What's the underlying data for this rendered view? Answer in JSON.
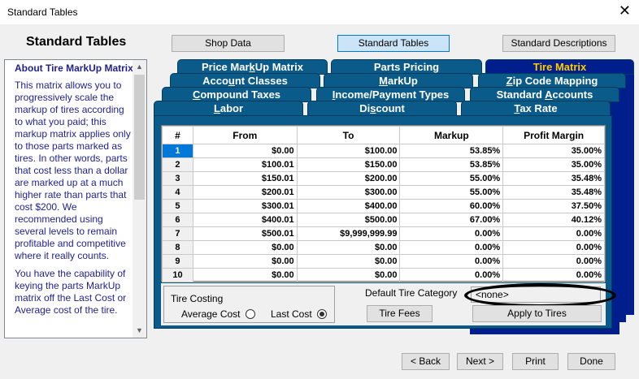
{
  "window": {
    "title": "Standard Tables"
  },
  "page": {
    "heading": "Standard Tables"
  },
  "top_buttons": [
    {
      "label": "Shop Data"
    },
    {
      "label": "Standard Tables"
    },
    {
      "label": "Standard Descriptions"
    }
  ],
  "side": {
    "title": "About Tire MarkUp Matrix",
    "p1": "This matrix allows you to progressively scale the markup of tires according to what you paid; this markup matrix applies only to those parts marked as tires. In other words, parts that cost less than a dollar are marked up at a much higher rate than parts that cost $200. We recommended using several levels to remain profitable and competitive where it really counts.",
    "p2": "You have the capability of keying the parts MarkUp matrix off the Last Cost or Average cost of the tire."
  },
  "tabs": {
    "row1": [
      {
        "pre": "Price Mar",
        "u": "k",
        "post": "Up Matrix"
      },
      {
        "pre": "Parts Pricin",
        "u": "g",
        "post": ""
      },
      {
        "pre": "Tire Matrix",
        "u": "",
        "post": ""
      }
    ],
    "row2": [
      {
        "pre": "Acco",
        "u": "u",
        "post": "nt Classes"
      },
      {
        "pre": "",
        "u": "M",
        "post": "arkUp"
      },
      {
        "pre": "",
        "u": "Z",
        "post": "ip Code Mapping"
      }
    ],
    "row3": [
      {
        "pre": "",
        "u": "C",
        "post": "ompound Taxes"
      },
      {
        "pre": "",
        "u": "I",
        "post": "ncome/Payment Types"
      },
      {
        "pre": "Standard ",
        "u": "A",
        "post": "ccounts"
      }
    ],
    "row4": [
      {
        "pre": "",
        "u": "L",
        "post": "abor"
      },
      {
        "pre": "Di",
        "u": "s",
        "post": "count"
      },
      {
        "pre": "",
        "u": "T",
        "post": "ax Rate"
      }
    ]
  },
  "table": {
    "headers": [
      "#",
      "From",
      "To",
      "Markup",
      "Profit Margin"
    ],
    "rows": [
      [
        "1",
        "$0.00",
        "$100.00",
        "53.85%",
        "35.00%"
      ],
      [
        "2",
        "$100.01",
        "$150.00",
        "53.85%",
        "35.00%"
      ],
      [
        "3",
        "$150.01",
        "$200.00",
        "55.00%",
        "35.48%"
      ],
      [
        "4",
        "$200.01",
        "$300.00",
        "55.00%",
        "35.48%"
      ],
      [
        "5",
        "$300.01",
        "$400.00",
        "60.00%",
        "37.50%"
      ],
      [
        "6",
        "$400.01",
        "$500.00",
        "67.00%",
        "40.12%"
      ],
      [
        "7",
        "$500.01",
        "$9,999,999.99",
        "0.00%",
        "0.00%"
      ],
      [
        "8",
        "$0.00",
        "$0.00",
        "0.00%",
        "0.00%"
      ],
      [
        "9",
        "$0.00",
        "$0.00",
        "0.00%",
        "0.00%"
      ],
      [
        "10",
        "$0.00",
        "$0.00",
        "0.00%",
        "0.00%"
      ]
    ]
  },
  "costing": {
    "legend": "Tire Costing",
    "average": "Average Cost",
    "last": "Last Cost",
    "selected": "Last Cost"
  },
  "category": {
    "label": "Default Tire Category",
    "value": "<none>"
  },
  "actions": {
    "tire_fees": "Tire Fees",
    "apply": "Apply to Tires"
  },
  "footer": {
    "back": "< Back",
    "next": "Next >",
    "print": "Print",
    "done": "Done"
  },
  "colors": {
    "tab": "#0b5b8a",
    "selected_tab": "#001f8c",
    "selected_tab_text": "#ffcc00",
    "side_text": "#1f1f8f"
  }
}
